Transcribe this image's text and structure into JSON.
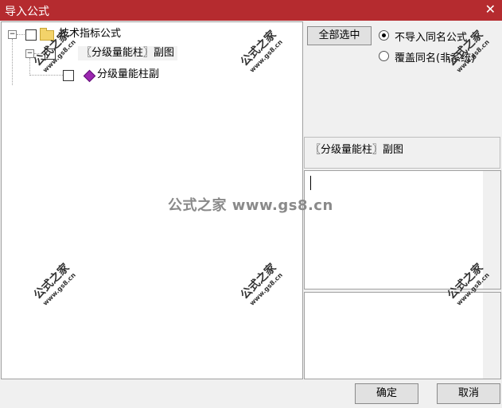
{
  "window": {
    "title": "导入公式",
    "close_glyph": "✕"
  },
  "tree": {
    "root": {
      "label": "技术指标公式",
      "expander": "−"
    },
    "child": {
      "label": "〖分级量能柱〗副图",
      "expander": "−"
    },
    "leaf": {
      "label": "分级量能柱副"
    }
  },
  "options": {
    "select_all": "全部选中",
    "radio_skip": "不导入同名公式",
    "radio_overwrite": "覆盖同名(非系统)"
  },
  "formula_name": "〖分级量能柱〗副图",
  "buttons": {
    "ok": "确定",
    "cancel": "取消"
  },
  "watermark": {
    "center": "公式之家 www.gs8.cn",
    "stamp_text": "公式之家",
    "stamp_url": "www.gs8.cn"
  }
}
